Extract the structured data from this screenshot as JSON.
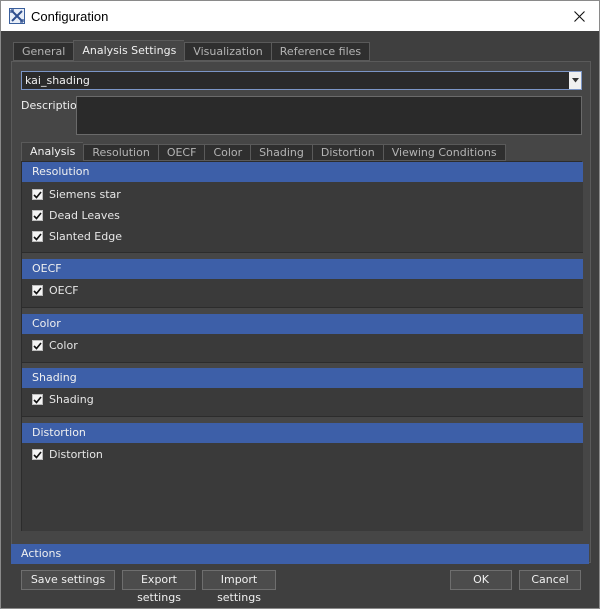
{
  "window": {
    "title": "Configuration"
  },
  "icons": {
    "app": "app-logo-icon",
    "close": "close-icon",
    "dropdown": "chevron-down-icon",
    "check": "checkmark-icon"
  },
  "colors": {
    "accent": "#3d5fa8",
    "background": "#3f3f3f",
    "panel": "#464646"
  },
  "top_tabs": [
    {
      "label": "General",
      "active": false
    },
    {
      "label": "Analysis Settings",
      "active": true
    },
    {
      "label": "Visualization",
      "active": false
    },
    {
      "label": "Reference files",
      "active": false
    }
  ],
  "profile": {
    "selected": "kai_shading"
  },
  "description": {
    "label": "Description",
    "value": ""
  },
  "sub_tabs": [
    {
      "label": "Analysis",
      "active": true
    },
    {
      "label": "Resolution",
      "active": false
    },
    {
      "label": "OECF",
      "active": false
    },
    {
      "label": "Color",
      "active": false
    },
    {
      "label": "Shading",
      "active": false
    },
    {
      "label": "Distortion",
      "active": false
    },
    {
      "label": "Viewing Conditions",
      "active": false
    }
  ],
  "sections": [
    {
      "title": "Resolution",
      "items": [
        {
          "label": "Siemens star",
          "checked": true
        },
        {
          "label": "Dead Leaves",
          "checked": true
        },
        {
          "label": "Slanted Edge",
          "checked": true
        }
      ]
    },
    {
      "title": "OECF",
      "items": [
        {
          "label": "OECF",
          "checked": true
        }
      ]
    },
    {
      "title": "Color",
      "items": [
        {
          "label": "Color",
          "checked": true
        }
      ]
    },
    {
      "title": "Shading",
      "items": [
        {
          "label": "Shading",
          "checked": true
        }
      ]
    },
    {
      "title": "Distortion",
      "items": [
        {
          "label": "Distortion",
          "checked": true
        }
      ]
    }
  ],
  "actions": {
    "title": "Actions",
    "save": "Save settings",
    "export": "Export settings",
    "import": "Import settings",
    "ok": "OK",
    "cancel": "Cancel"
  }
}
